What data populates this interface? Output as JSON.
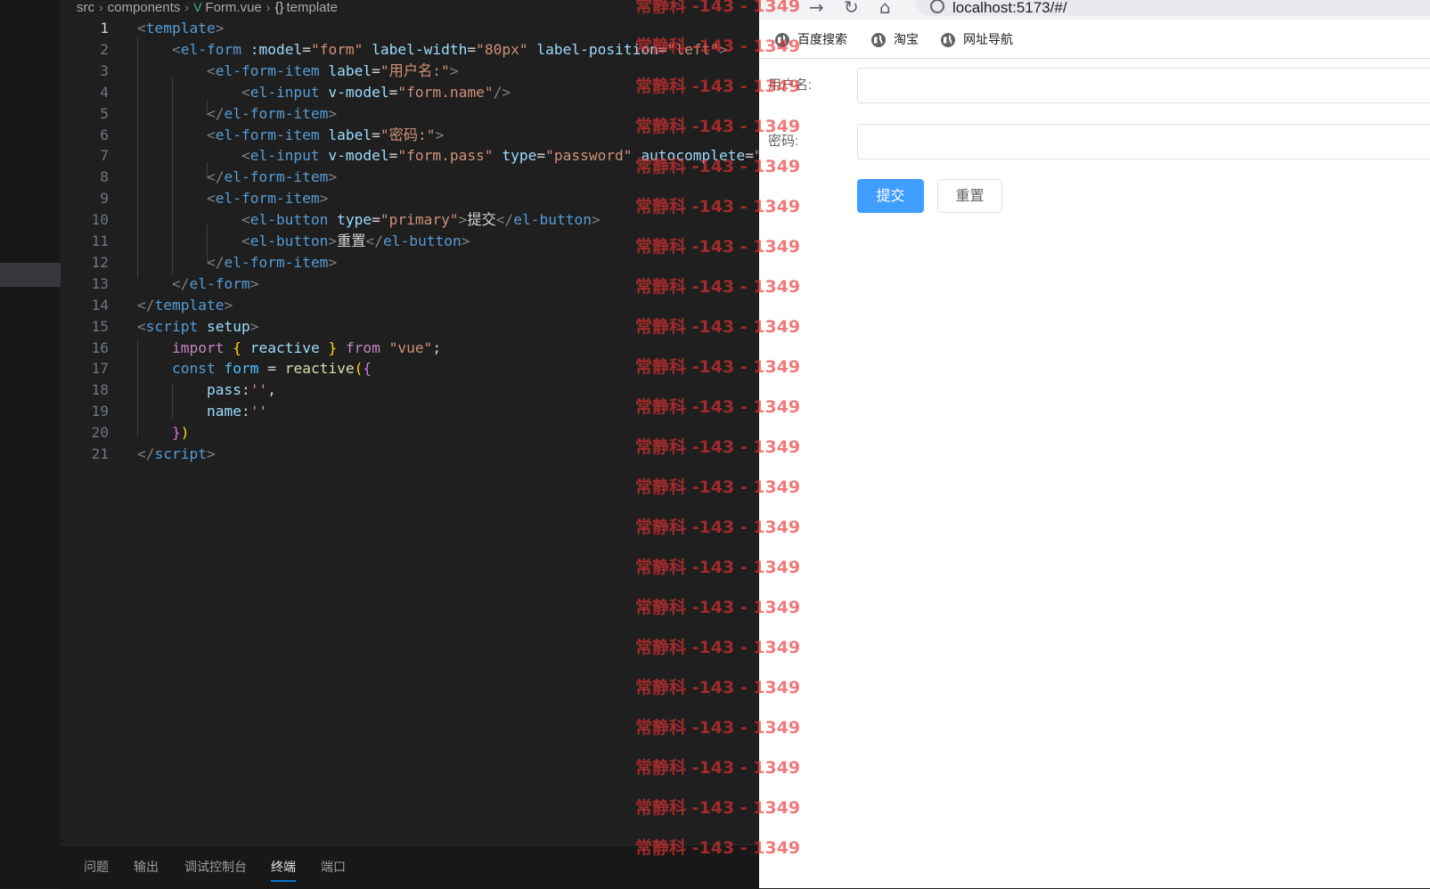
{
  "editor": {
    "breadcrumb": {
      "src": "src",
      "components": "components",
      "vue_icon": "V",
      "file": "Form.vue",
      "braces": "{}",
      "symbol": "template"
    },
    "active_line": 1,
    "code_lines": [
      [
        [
          "pn",
          "<"
        ],
        [
          "tg",
          "template"
        ],
        [
          "pn",
          ">"
        ]
      ],
      [
        [
          "tx",
          "    "
        ],
        [
          "pn",
          "<"
        ],
        [
          "tg",
          "el-form"
        ],
        [
          "tx",
          " "
        ],
        [
          "at",
          ":model"
        ],
        [
          "tx",
          "="
        ],
        [
          "st",
          "\"form\""
        ],
        [
          "tx",
          " "
        ],
        [
          "at",
          "label-width"
        ],
        [
          "tx",
          "="
        ],
        [
          "st",
          "\"80px\""
        ],
        [
          "tx",
          " "
        ],
        [
          "at",
          "label-position"
        ],
        [
          "tx",
          "="
        ],
        [
          "st",
          "\"left\""
        ],
        [
          "pn",
          ">"
        ]
      ],
      [
        [
          "tx",
          "        "
        ],
        [
          "pn",
          "<"
        ],
        [
          "tg",
          "el-form-item"
        ],
        [
          "tx",
          " "
        ],
        [
          "at",
          "label"
        ],
        [
          "tx",
          "="
        ],
        [
          "st",
          "\"用户名:\""
        ],
        [
          "pn",
          ">"
        ]
      ],
      [
        [
          "tx",
          "            "
        ],
        [
          "pn",
          "<"
        ],
        [
          "tg",
          "el-input"
        ],
        [
          "tx",
          " "
        ],
        [
          "at",
          "v-model"
        ],
        [
          "tx",
          "="
        ],
        [
          "st",
          "\"form.name\""
        ],
        [
          "pn",
          "/>"
        ]
      ],
      [
        [
          "tx",
          "        "
        ],
        [
          "pn",
          "</"
        ],
        [
          "tg",
          "el-form-item"
        ],
        [
          "pn",
          ">"
        ]
      ],
      [
        [
          "tx",
          "        "
        ],
        [
          "pn",
          "<"
        ],
        [
          "tg",
          "el-form-item"
        ],
        [
          "tx",
          " "
        ],
        [
          "at",
          "label"
        ],
        [
          "tx",
          "="
        ],
        [
          "st",
          "\"密码:\""
        ],
        [
          "pn",
          ">"
        ]
      ],
      [
        [
          "tx",
          "            "
        ],
        [
          "pn",
          "<"
        ],
        [
          "tg",
          "el-input"
        ],
        [
          "tx",
          " "
        ],
        [
          "at",
          "v-model"
        ],
        [
          "tx",
          "="
        ],
        [
          "st",
          "\"form.pass\""
        ],
        [
          "tx",
          " "
        ],
        [
          "at",
          "type"
        ],
        [
          "tx",
          "="
        ],
        [
          "st",
          "\"password\""
        ],
        [
          "tx",
          " "
        ],
        [
          "at",
          "autocomplete"
        ],
        [
          "tx",
          "="
        ],
        [
          "st",
          "\"o"
        ]
      ],
      [
        [
          "tx",
          "        "
        ],
        [
          "pn",
          "</"
        ],
        [
          "tg",
          "el-form-item"
        ],
        [
          "pn",
          ">"
        ]
      ],
      [
        [
          "tx",
          "        "
        ],
        [
          "pn",
          "<"
        ],
        [
          "tg",
          "el-form-item"
        ],
        [
          "pn",
          ">"
        ]
      ],
      [
        [
          "tx",
          "            "
        ],
        [
          "pn",
          "<"
        ],
        [
          "tg",
          "el-button"
        ],
        [
          "tx",
          " "
        ],
        [
          "at",
          "type"
        ],
        [
          "tx",
          "="
        ],
        [
          "st",
          "\"primary\""
        ],
        [
          "pn",
          ">"
        ],
        [
          "tx",
          "提交"
        ],
        [
          "pn",
          "</"
        ],
        [
          "tg",
          "el-button"
        ],
        [
          "pn",
          ">"
        ]
      ],
      [
        [
          "tx",
          "            "
        ],
        [
          "pn",
          "<"
        ],
        [
          "tg",
          "el-button"
        ],
        [
          "pn",
          ">"
        ],
        [
          "tx",
          "重置"
        ],
        [
          "pn",
          "</"
        ],
        [
          "tg",
          "el-button"
        ],
        [
          "pn",
          ">"
        ]
      ],
      [
        [
          "tx",
          "        "
        ],
        [
          "pn",
          "</"
        ],
        [
          "tg",
          "el-form-item"
        ],
        [
          "pn",
          ">"
        ]
      ],
      [
        [
          "tx",
          "    "
        ],
        [
          "pn",
          "</"
        ],
        [
          "tg",
          "el-form"
        ],
        [
          "pn",
          ">"
        ]
      ],
      [
        [
          "pn",
          "</"
        ],
        [
          "tg",
          "template"
        ],
        [
          "pn",
          ">"
        ]
      ],
      [
        [
          "pn",
          "<"
        ],
        [
          "tg",
          "script"
        ],
        [
          "tx",
          " "
        ],
        [
          "at",
          "setup"
        ],
        [
          "pn",
          ">"
        ]
      ],
      [
        [
          "tx",
          "    "
        ],
        [
          "kw",
          "import"
        ],
        [
          "tx",
          " "
        ],
        [
          "br",
          "{"
        ],
        [
          "tx",
          " "
        ],
        [
          "vr",
          "reactive"
        ],
        [
          "tx",
          " "
        ],
        [
          "br",
          "}"
        ],
        [
          "tx",
          " "
        ],
        [
          "kw",
          "from"
        ],
        [
          "tx",
          " "
        ],
        [
          "st",
          "\"vue\""
        ],
        [
          "tx",
          ";"
        ]
      ],
      [
        [
          "tx",
          "    "
        ],
        [
          "cs",
          "const"
        ],
        [
          "tx",
          " "
        ],
        [
          "id",
          "form"
        ],
        [
          "tx",
          " = "
        ],
        [
          "fn",
          "reactive"
        ],
        [
          "br",
          "("
        ],
        [
          "bp",
          "{"
        ]
      ],
      [
        [
          "tx",
          "        "
        ],
        [
          "vr",
          "pass"
        ],
        [
          "tx",
          ":"
        ],
        [
          "st",
          "''"
        ],
        [
          "tx",
          ","
        ]
      ],
      [
        [
          "tx",
          "        "
        ],
        [
          "vr",
          "name"
        ],
        [
          "tx",
          ":"
        ],
        [
          "st",
          "''"
        ]
      ],
      [
        [
          "tx",
          "    "
        ],
        [
          "bp",
          "}"
        ],
        [
          "br",
          ")"
        ]
      ],
      [
        [
          "pn",
          "</"
        ],
        [
          "tg",
          "script"
        ],
        [
          "pn",
          ">"
        ]
      ]
    ],
    "panel_tabs": [
      "问题",
      "输出",
      "调试控制台",
      "终端",
      "端口"
    ],
    "active_panel_tab": "终端"
  },
  "browser": {
    "url": "localhost:5173/#/",
    "bookmarks": [
      "百度搜索",
      "淘宝",
      "网址导航"
    ],
    "form": {
      "username_label": "用户名:",
      "password_label": "密码:",
      "submit_label": "提交",
      "reset_label": "重置"
    }
  },
  "watermark": {
    "text": "常静科 -143 - 1349",
    "repeat": 22
  },
  "colors": {
    "editor_bg": "#1f1f1f",
    "primary_button": "#409eff",
    "watermark": "#e83232"
  }
}
